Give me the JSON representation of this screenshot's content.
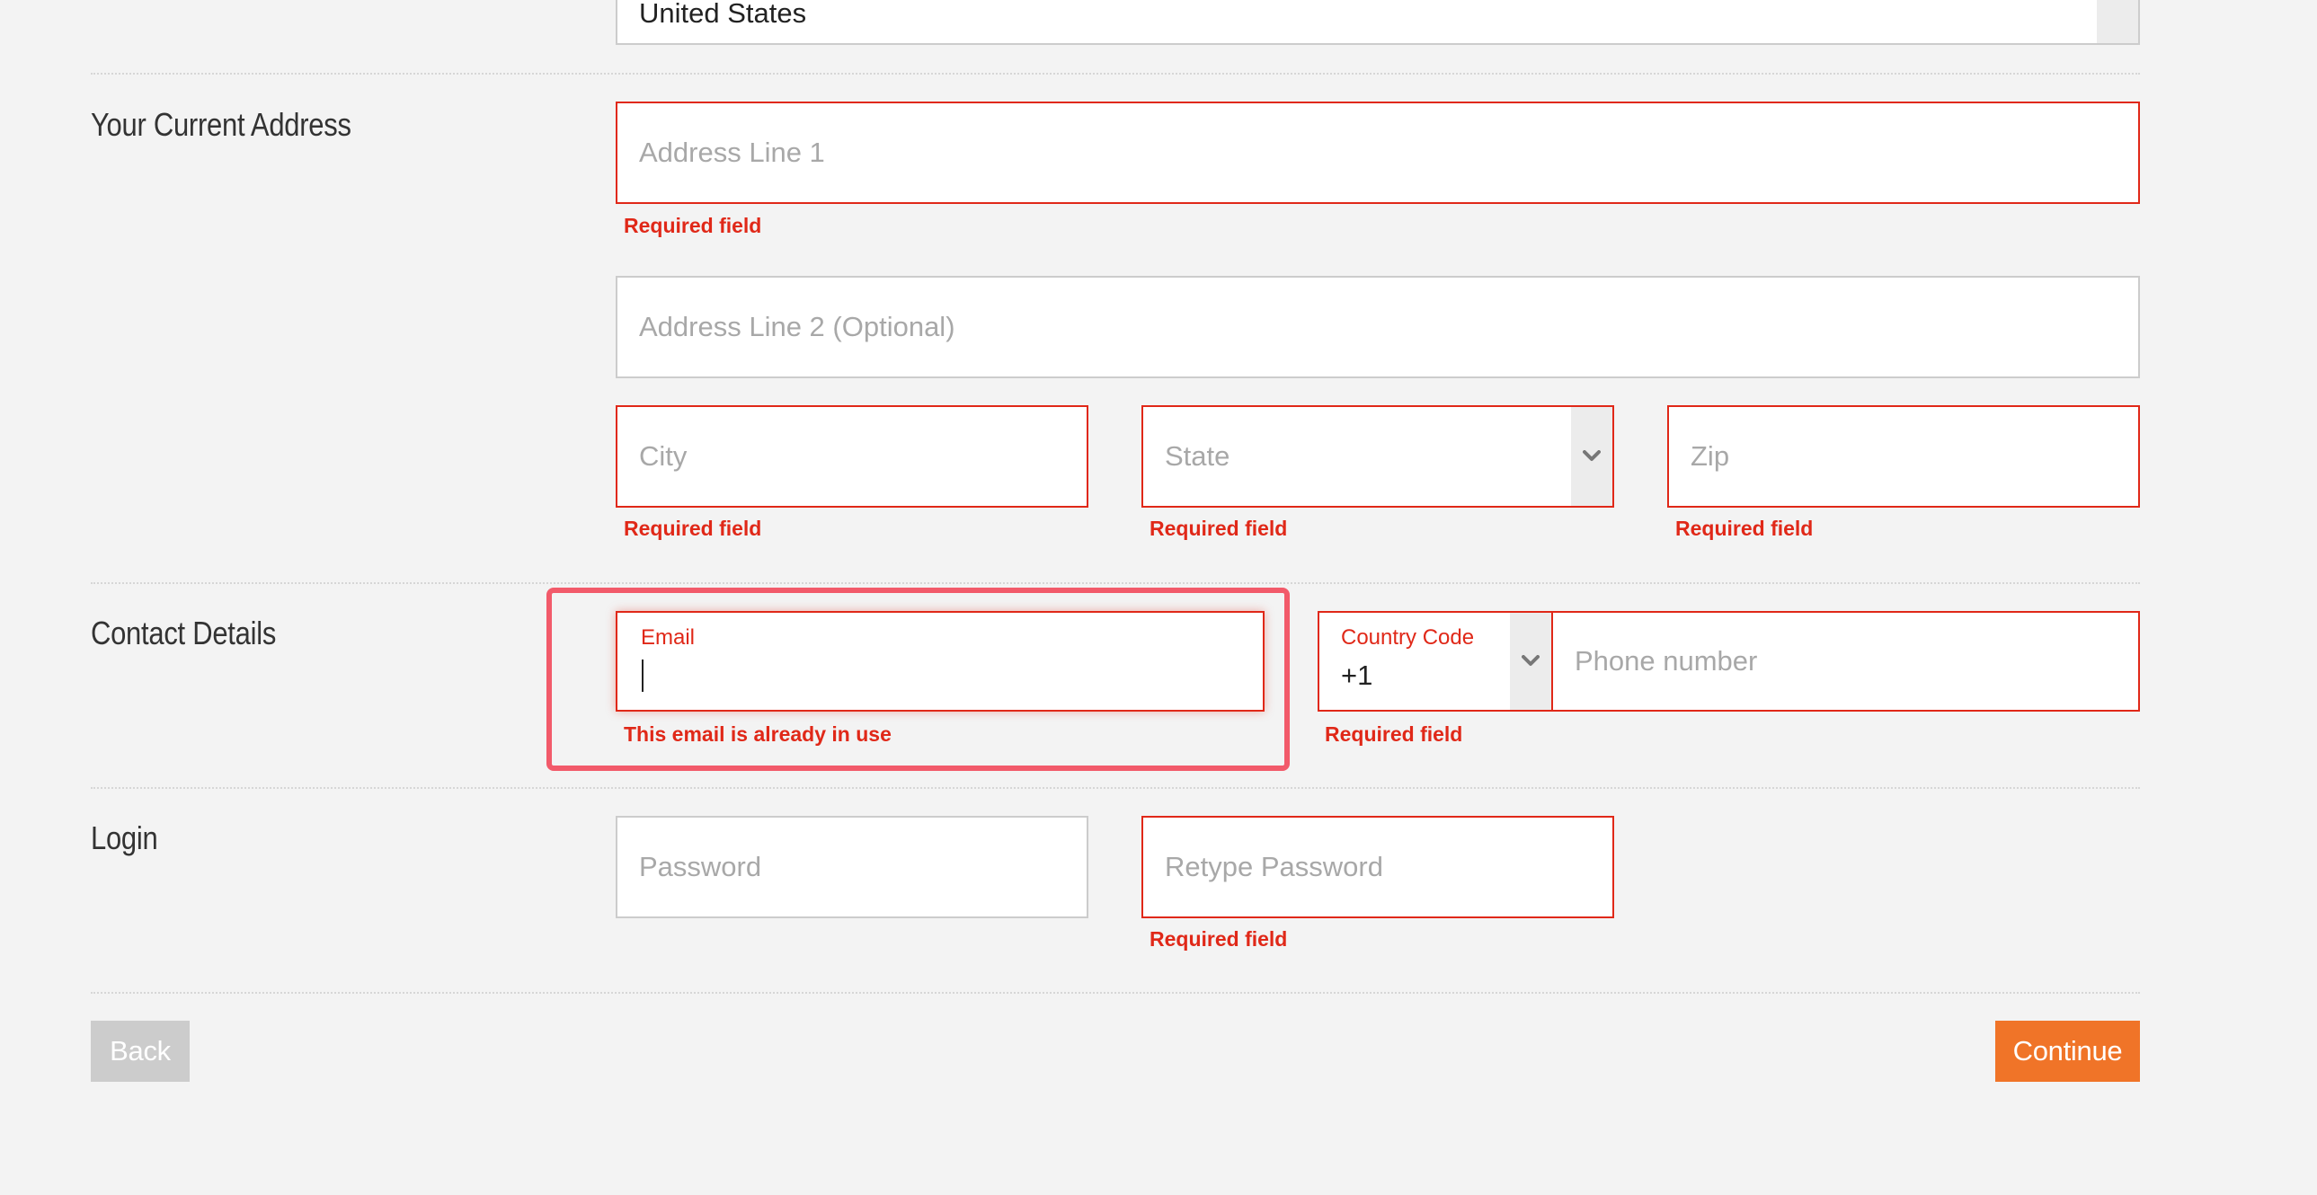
{
  "country": {
    "selected": "United States"
  },
  "address": {
    "section_label": "Your Current Address",
    "line1_placeholder": "Address Line 1",
    "line1_error": "Required field",
    "line2_placeholder": "Address Line 2 (Optional)",
    "city_placeholder": "City",
    "city_error": "Required field",
    "state_placeholder": "State",
    "state_error": "Required field",
    "zip_placeholder": "Zip",
    "zip_error": "Required field"
  },
  "contact": {
    "section_label": "Contact Details",
    "email_label": "Email",
    "email_value": "",
    "email_error": "This email is already in use",
    "country_code_label": "Country Code",
    "country_code_value": "+1",
    "phone_placeholder": "Phone number",
    "phone_error": "Required field"
  },
  "login": {
    "section_label": "Login",
    "password_placeholder": "Password",
    "retype_placeholder": "Retype Password",
    "retype_error": "Required field"
  },
  "actions": {
    "back_label": "Back",
    "continue_label": "Continue"
  },
  "colors": {
    "error": "#e02818",
    "highlight": "#f25a6a",
    "accent": "#f07428",
    "disabled": "#cccccc"
  },
  "icons": {
    "dropdown": "chevron-down-icon"
  }
}
